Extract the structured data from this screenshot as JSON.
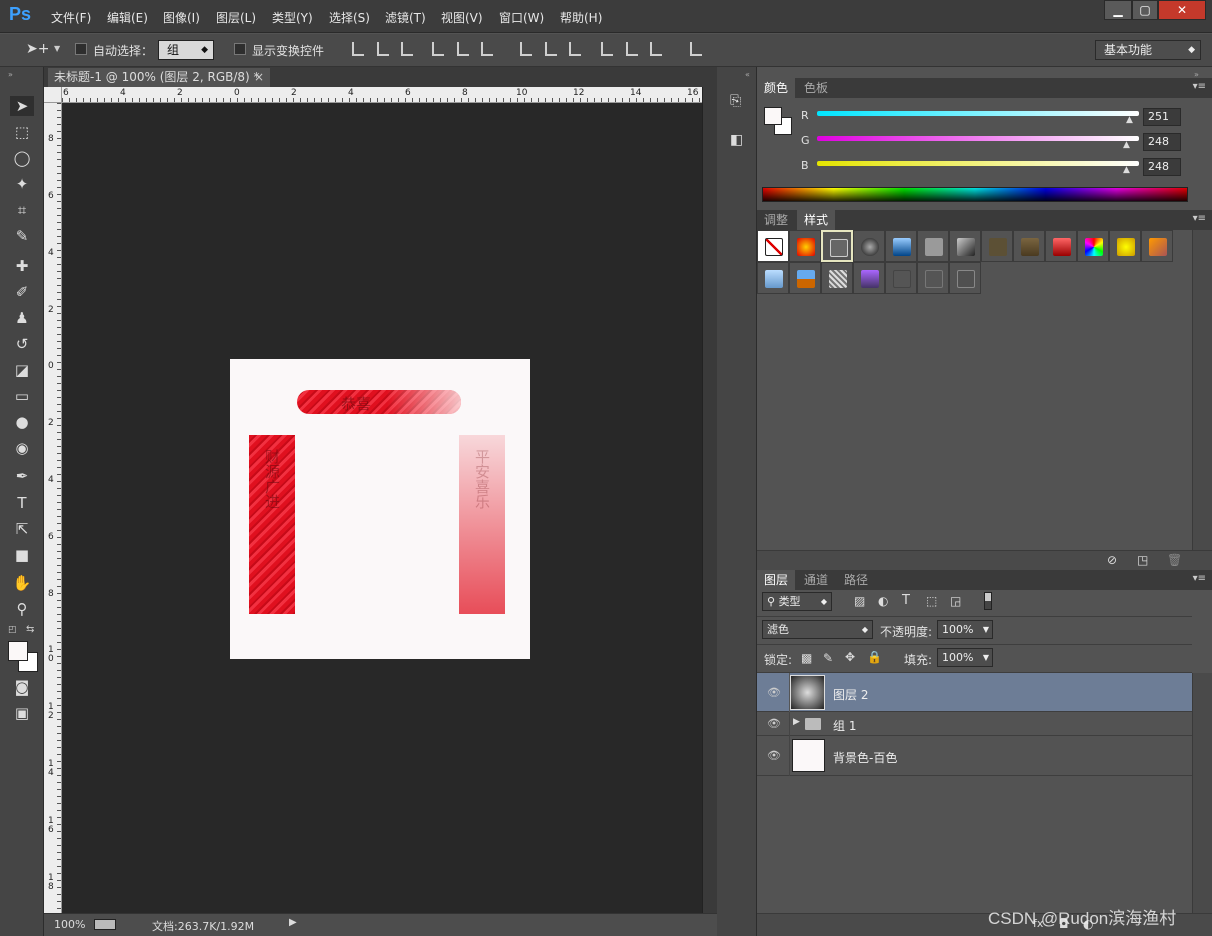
{
  "app": {
    "logo": "Ps"
  },
  "menu": [
    "文件(F)",
    "编辑(E)",
    "图像(I)",
    "图层(L)",
    "类型(Y)",
    "选择(S)",
    "滤镜(T)",
    "视图(V)",
    "窗口(W)",
    "帮助(H)"
  ],
  "window_controls": {
    "minimize": "▁",
    "maximize": "▢",
    "close": "✕"
  },
  "options": {
    "auto_select_label": "自动选择：",
    "auto_select_value": "组",
    "show_transform_label": "显示变换控件",
    "workspace": "基本功能"
  },
  "document": {
    "tab_title": "未标题-1 @ 100% (图层 2, RGB/8) *",
    "tab_close": "×",
    "banner_text": "恭喜",
    "left_vertical_text": "财源广进",
    "right_vertical_text": "平安喜乐"
  },
  "rulers": {
    "h": [
      "6",
      "4",
      "2",
      "0",
      "2",
      "4",
      "6",
      "8",
      "10",
      "12",
      "14",
      "16"
    ],
    "v": [
      "8",
      "6",
      "4",
      "2",
      "0",
      "2",
      "4",
      "6",
      "8",
      "1 0",
      "1 2",
      "1 4",
      "1 6",
      "1 8"
    ]
  },
  "status": {
    "zoom": "100%",
    "doc_info": "文档:263.7K/1.92M"
  },
  "color_panel": {
    "tabs": [
      "颜色",
      "色板"
    ],
    "r_label": "R",
    "g_label": "G",
    "b_label": "B",
    "r": "251",
    "g": "248",
    "b": "248",
    "accent_r": "#00e5ff",
    "accent_g": "#e000e0",
    "accent_b": "#e5e500"
  },
  "styles_panel": {
    "tabs": [
      "调整",
      "样式"
    ]
  },
  "layers_panel": {
    "tabs": [
      "图层",
      "通道",
      "路径"
    ],
    "filter_kind": "类型",
    "blend_mode": "滤色",
    "opacity_label": "不透明度:",
    "opacity_value": "100%",
    "lock_label": "锁定:",
    "fill_label": "填充:",
    "fill_value": "100%",
    "layers": [
      {
        "name": "图层 2"
      },
      {
        "name": "组 1"
      },
      {
        "name": "背景色-百色"
      }
    ]
  },
  "watermark": "CSDN @Rudon滨海渔村"
}
